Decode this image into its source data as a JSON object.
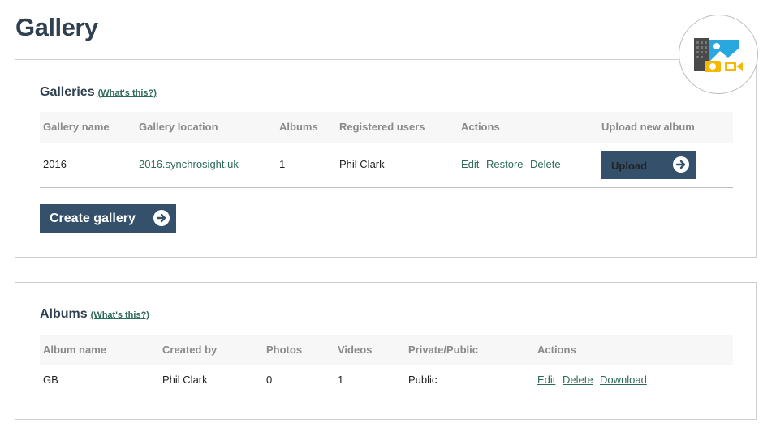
{
  "page": {
    "title": "Gallery"
  },
  "galleries": {
    "heading": "Galleries",
    "whats_this": "(What's this?)",
    "columns": [
      "Gallery name",
      "Gallery location",
      "Albums",
      "Registered users",
      "Actions",
      "Upload new album"
    ],
    "rows": [
      {
        "name": "2016",
        "location": "2016.synchrosight.uk",
        "albums": "1",
        "users": "Phil Clark",
        "actions": [
          "Edit",
          "Restore",
          "Delete"
        ],
        "upload_label": "Upload"
      }
    ],
    "create_label": "Create gallery"
  },
  "albums": {
    "heading": "Albums",
    "whats_this": "(What's this?)",
    "columns": [
      "Album name",
      "Created by",
      "Photos",
      "Videos",
      "Private/Public",
      "Actions"
    ],
    "rows": [
      {
        "name": "GB",
        "created_by": "Phil Clark",
        "photos": "0",
        "videos": "1",
        "visibility": "Public",
        "actions": [
          "Edit",
          "Delete",
          "Download"
        ]
      }
    ]
  },
  "icons": [
    "gallery-logo-icon",
    "arrow-right-icon"
  ],
  "colors": {
    "title": "#2f4050",
    "button": "#34506a",
    "link": "#2d6a5a"
  }
}
